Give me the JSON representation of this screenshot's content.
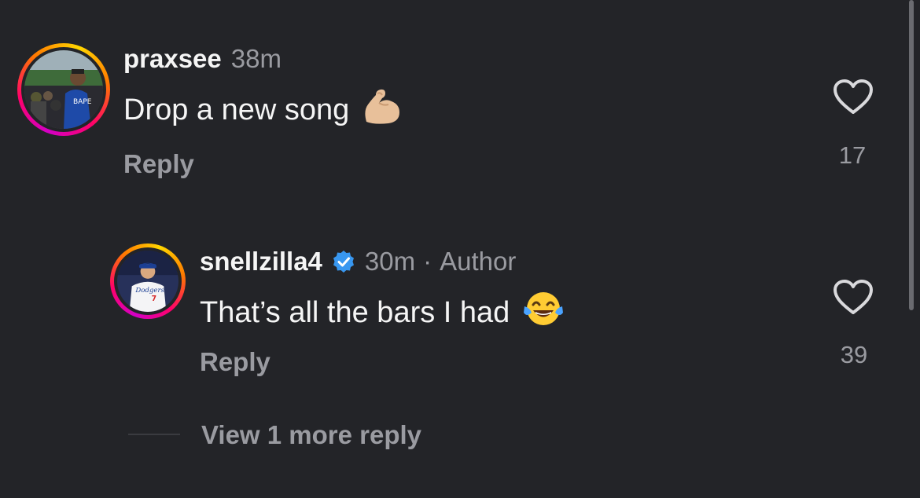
{
  "comments": [
    {
      "username": "praxsee",
      "time": "38m",
      "text": "Drop a new song",
      "emoji_icon": "flexed-biceps-icon",
      "reply_label": "Reply",
      "like_count": "17"
    },
    {
      "username": "snellzilla4",
      "verified_icon": "verified-badge-icon",
      "time": "30m",
      "separator": "·",
      "author_label": "Author",
      "text": "That’s all the bars I had",
      "emoji_icon": "tears-of-joy-icon",
      "reply_label": "Reply",
      "like_count": "39"
    }
  ],
  "view_more_label": "View 1 more reply",
  "colors": {
    "background": "#232428",
    "primary_text": "#f5f5f5",
    "secondary_text": "#9a9ba1",
    "verified": "#3897f0"
  }
}
